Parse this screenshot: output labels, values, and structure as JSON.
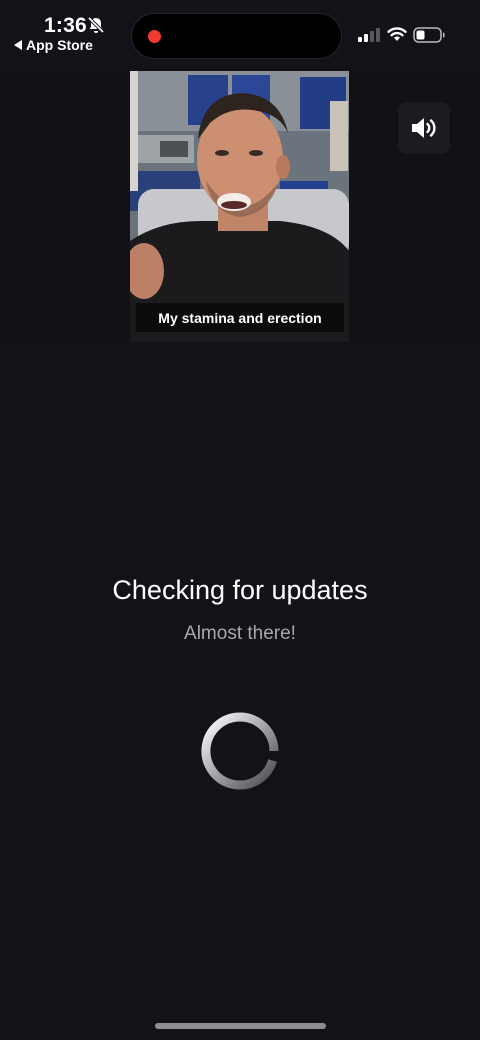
{
  "status_bar": {
    "time": "1:36",
    "back_label": "App Store",
    "icons": {
      "ringer": "bell-slash-icon",
      "signal": "cellular-signal-icon",
      "wifi": "wifi-icon",
      "battery": "battery-icon"
    },
    "recording_color": "#f03a2e"
  },
  "video": {
    "caption": "My stamina and erection",
    "sound_icon": "speaker-volume-icon"
  },
  "loading": {
    "title": "Checking for updates",
    "subtitle": "Almost there!",
    "spinner_icon": "spinner-icon"
  },
  "colors": {
    "background": "#141218",
    "subtitle": "#a9a7ad"
  }
}
